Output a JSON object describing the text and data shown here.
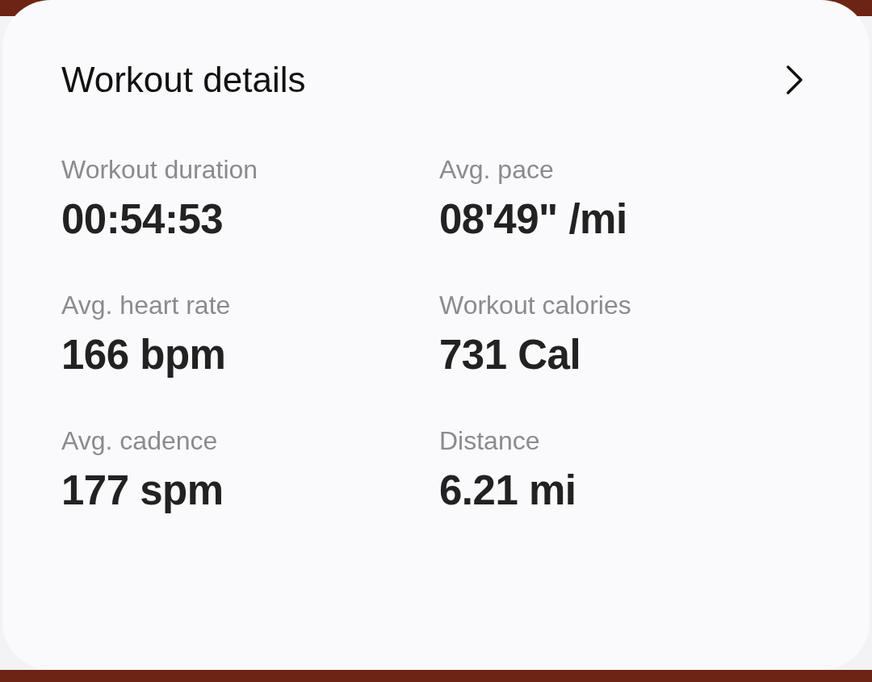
{
  "card": {
    "title": "Workout details",
    "stats": [
      {
        "label": "Workout duration",
        "value": "00:54:53"
      },
      {
        "label": "Avg. pace",
        "value": "08'49\" /mi"
      },
      {
        "label": "Avg. heart rate",
        "value": "166 bpm"
      },
      {
        "label": "Workout calories",
        "value": "731 Cal"
      },
      {
        "label": "Avg. cadence",
        "value": "177 spm"
      },
      {
        "label": "Distance",
        "value": "6.21 mi"
      }
    ]
  }
}
